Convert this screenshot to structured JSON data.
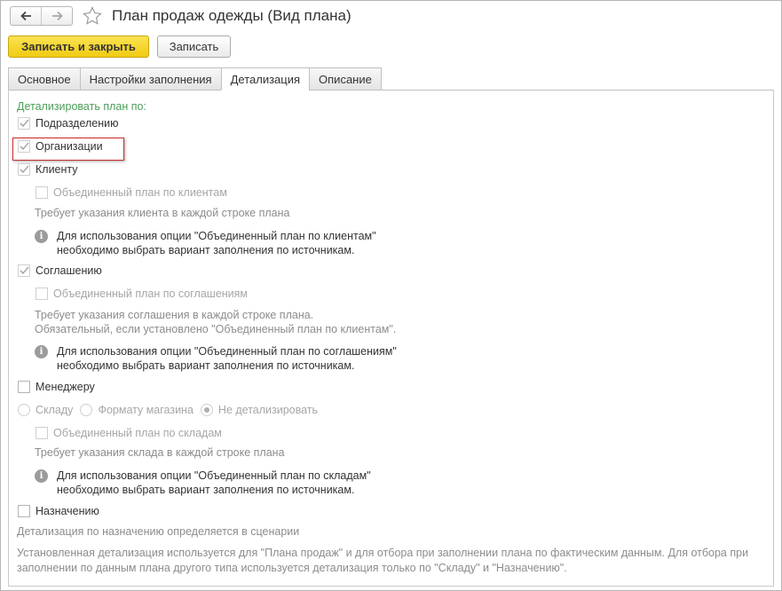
{
  "window": {
    "title": "План продаж одежды (Вид плана)"
  },
  "toolbar": {
    "write_close_label": "Записать и закрыть",
    "write_label": "Записать"
  },
  "tabs": [
    {
      "label": "Основное",
      "active": false
    },
    {
      "label": "Настройки заполнения",
      "active": false
    },
    {
      "label": "Детализация",
      "active": true
    },
    {
      "label": "Описание",
      "active": false
    }
  ],
  "detail": {
    "section_label": "Детализировать план по:",
    "by_department": {
      "label": "Подразделению",
      "checked": true,
      "disabled": true
    },
    "by_organization": {
      "label": "Организации",
      "checked": true,
      "disabled": true
    },
    "by_client": {
      "label": "Клиенту",
      "checked": true,
      "disabled": true,
      "combined": {
        "label": "Объединенный план по клиентам",
        "checked": false,
        "disabled": true
      },
      "hint": "Требует указания клиента в каждой строке плана",
      "info": [
        "Для использования опции \"Объединенный план по клиентам\"",
        "необходимо выбрать вариант заполнения по источникам."
      ]
    },
    "by_agreement": {
      "label": "Соглашению",
      "checked": true,
      "disabled": true,
      "combined": {
        "label": "Объединенный план по соглашениям",
        "checked": false,
        "disabled": true
      },
      "hint": [
        "Требует указания соглашения в каждой строке плана.",
        "Обязательный, если установлено \"Объединенный план по клиентам\"."
      ],
      "info": [
        "Для использования опции \"Объединенный план по соглашениям\"",
        "необходимо выбрать вариант заполнения по источникам."
      ]
    },
    "by_manager": {
      "label": "Менеджеру",
      "checked": false,
      "disabled": false
    },
    "warehouse_options": [
      {
        "label": "Складу",
        "selected": false
      },
      {
        "label": "Формату магазина",
        "selected": false
      },
      {
        "label": "Не детализировать",
        "selected": true
      }
    ],
    "by_warehouse": {
      "combined": {
        "label": "Объединенный план по складам",
        "checked": false,
        "disabled": true
      },
      "hint": "Требует указания склада в каждой строке плана",
      "info": [
        "Для использования опции \"Объединенный план по складам\"",
        "необходимо выбрать вариант заполнения по источникам."
      ]
    },
    "by_purpose": {
      "label": "Назначению",
      "checked": false,
      "disabled": false
    },
    "purpose_hint": "Детализация по назначению определяется в сценарии",
    "footer_note": "Установленная детализация используется для \"Плана продаж\" и для отбора при заполнении плана по фактическим данным. Для отбора при заполнении по данным плана другого типа используется детализация только по \"Складу\" и \"Назначению\"."
  },
  "colors": {
    "accent_yellow": "#f5d31e",
    "section_green": "#4c9e58",
    "highlight_red": "#cf2b2b",
    "hint_gray": "#8c8c8c"
  },
  "icons": {
    "back": "arrow-left-icon",
    "forward": "arrow-right-icon",
    "favorite": "star-icon",
    "info": "info-icon",
    "check": "checkmark-icon"
  }
}
